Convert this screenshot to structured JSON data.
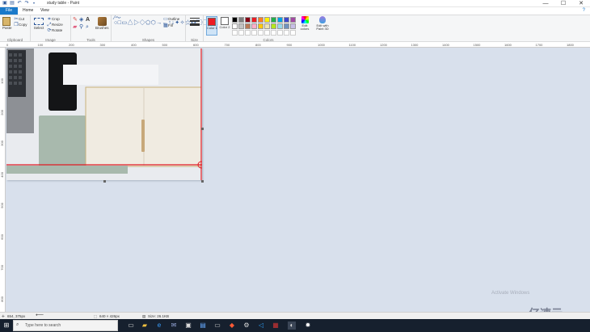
{
  "window": {
    "title": "study table - Paint",
    "minimize_glyph": "—",
    "maximize_glyph": "☐",
    "close_glyph": "✕"
  },
  "tabs": [
    "File",
    "Home",
    "View"
  ],
  "ribbon": {
    "clipboard": {
      "label": "Clipboard",
      "paste": "Paste",
      "cut": "Cut",
      "copy": "Copy"
    },
    "image": {
      "label": "Image",
      "select": "Select",
      "crop": "Crop",
      "resize": "Resize",
      "rotate": "Rotate"
    },
    "tools": {
      "label": "Tools",
      "brushes": "Brushes"
    },
    "shapes": {
      "label": "Shapes",
      "outline": "Outline",
      "fill": "Fill"
    },
    "size": {
      "label": "Size"
    },
    "colors": {
      "label": "Colors",
      "color1": "Color 1",
      "color2": "Color 2",
      "edit_colors": "Edit colors",
      "paint3d": "Edit with Paint 3D",
      "palette_row1": [
        "#000000",
        "#7f7f7f",
        "#880015",
        "#ed1c24",
        "#ff7f27",
        "#fff200",
        "#22b14c",
        "#00a2e8",
        "#3f48cc",
        "#a349a4"
      ],
      "palette_row2": [
        "#ffffff",
        "#c3c3c3",
        "#b97a57",
        "#ffaec9",
        "#ffc90e",
        "#efe4b0",
        "#b5e61d",
        "#99d9ea",
        "#7092be",
        "#c8bfe7"
      ],
      "color1_value": "#ed1c24",
      "color2_value": "#ffffff"
    }
  },
  "ruler_h_ticks": [
    "0",
    "100",
    "200",
    "300",
    "400",
    "500",
    "600",
    "700",
    "800",
    "900",
    "1000",
    "1100",
    "1200",
    "1300",
    "1400",
    "1500",
    "1600",
    "1700",
    "1800"
  ],
  "ruler_v_ticks": [
    "100",
    "200",
    "300",
    "400",
    "500",
    "600",
    "700",
    "800"
  ],
  "status": {
    "position": "654, 375px",
    "selection_size": "640 × 426px",
    "file_size": "Size: 26.1KB"
  },
  "watermark": {
    "activate": "Activate Windows",
    "brand": "亿速云"
  },
  "taskbar": {
    "search_placeholder": "Type here to search"
  }
}
